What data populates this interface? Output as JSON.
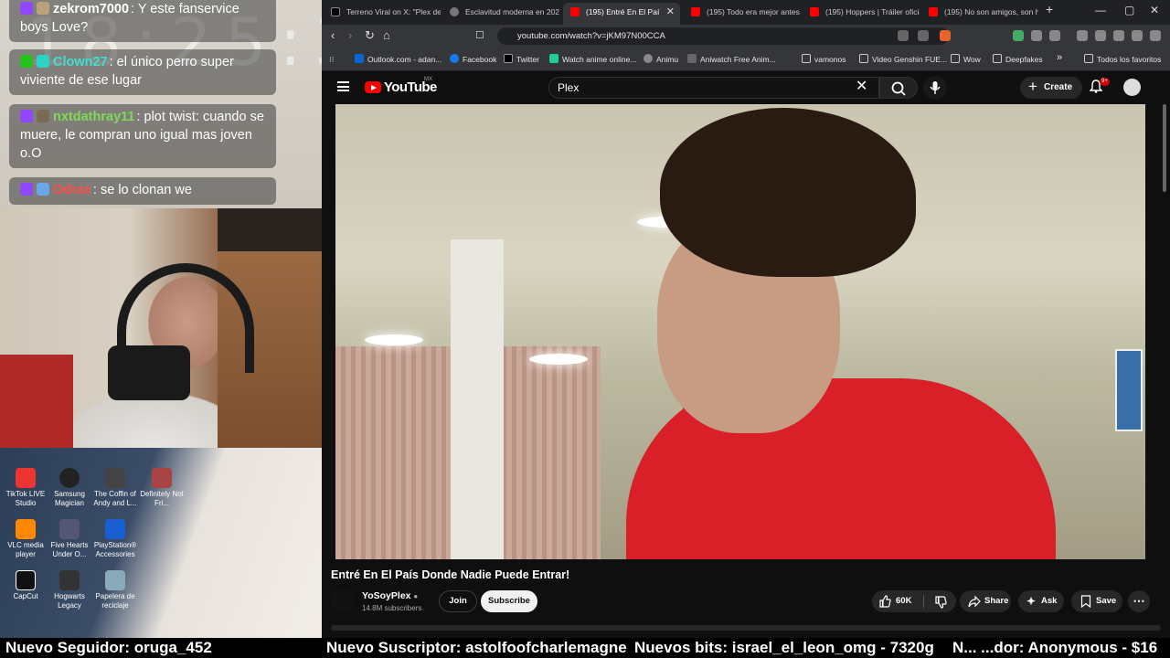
{
  "overlay": {
    "clock": "18:25:38",
    "chat": [
      {
        "user": "zekrom7000",
        "user_color": "#ffffff",
        "text": ": Y este fanservice boys Love?"
      },
      {
        "user": "Clown27",
        "user_color": "#3fe0d0",
        "text": ": el único perro super viviente de ese lugar"
      },
      {
        "user": "nxtdathray11",
        "user_color": "#7ed957",
        "text": ": plot twist: cuando se muere, le compran uno igual mas joven o.O"
      },
      {
        "user": "Odrax",
        "user_color": "#ff4b4b",
        "text": ": se lo clonan we"
      }
    ],
    "desktop_icons": [
      {
        "label": "TikTok LIVE Studio",
        "color": "#e33"
      },
      {
        "label": "Samsung Magician",
        "color": "#222"
      },
      {
        "label": "The Coffin of Andy and L...",
        "color": "#444"
      },
      {
        "label": "Definitely Not Fri...",
        "color": "#a44"
      },
      {
        "label": "VLC media player",
        "color": "#f80"
      },
      {
        "label": "Five Hearts Under O...",
        "color": "#557"
      },
      {
        "label": "PlayStation® Accessories",
        "color": "#1a5fd1"
      },
      {
        "label": "CapCut",
        "color": "#111"
      },
      {
        "label": "Hogwarts Legacy",
        "color": "#333"
      },
      {
        "label": "Papelera de reciclaje",
        "color": "#8ab"
      }
    ],
    "ticker": {
      "follower": "Nuevo Seguidor: oruga_452",
      "subscriber": "Nuevo Suscriptor: astolfoofcharlemagne",
      "bits": "Nuevos bits: israel_el_leon_omg - 7320g",
      "donor": "N... ...dor: Anonymous - $16"
    }
  },
  "browser": {
    "tabs": [
      {
        "title": "Terreno Viral on X: \"Plex de",
        "icon": "x-icon",
        "color": "#000"
      },
      {
        "title": "Esclavitud moderna en 2024",
        "icon": "chatgpt-icon",
        "color": "#777"
      },
      {
        "title": "(195) Entré En El Paí",
        "icon": "youtube-icon",
        "color": "#f00",
        "active": true
      },
      {
        "title": "(195) Todo era mejor antes",
        "icon": "youtube-icon",
        "color": "#f00"
      },
      {
        "title": "(195) Hoppers | Tráiler oficia",
        "icon": "youtube-icon",
        "color": "#f00"
      },
      {
        "title": "(195) No son amigos, son h",
        "icon": "youtube-icon",
        "color": "#f00"
      }
    ],
    "url": "youtube.com/watch?v=jKM97N00CCA",
    "bookmarks": [
      {
        "label": "Outlook.com - adan...",
        "color": "#0a64d8"
      },
      {
        "label": "Facebook",
        "color": "#1877f2"
      },
      {
        "label": "Twitter",
        "color": "#000"
      },
      {
        "label": "Watch anime online...",
        "color": "#2c9"
      },
      {
        "label": "Animu",
        "color": "#888"
      },
      {
        "label": "Aniwatch Free Anim...",
        "color": "#666"
      },
      {
        "label": "vamonos",
        "color": "folder"
      },
      {
        "label": "Video Genshin FUE...",
        "color": "folder"
      },
      {
        "label": "Wow",
        "color": "folder"
      },
      {
        "label": "Deepfakes",
        "color": "folder"
      }
    ],
    "all_bookmarks": "Todos los favoritos"
  },
  "youtube": {
    "logo": "YouTube",
    "country": "MX",
    "search_value": "Plex",
    "create_label": "Create",
    "notif_count": "9+",
    "video_title": "Entré En El País Donde Nadie Puede Entrar!",
    "channel": "YoSoyPlex",
    "subscribers": "14.8M subscribers",
    "join_label": "Join",
    "subscribe_label": "Subscribe",
    "likes": "60K",
    "share_label": "Share",
    "ask_label": "Ask",
    "save_label": "Save"
  }
}
